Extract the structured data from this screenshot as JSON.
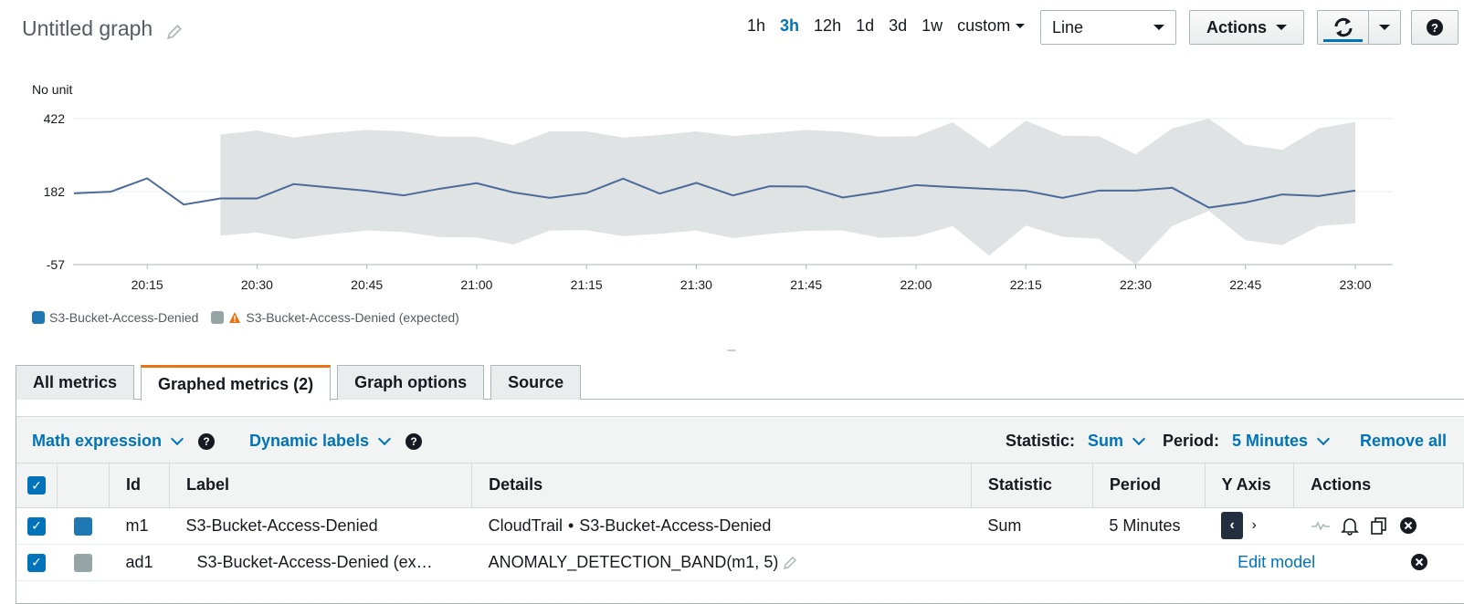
{
  "header": {
    "title": "Untitled graph",
    "time_ranges": [
      "1h",
      "3h",
      "12h",
      "1d",
      "3d",
      "1w"
    ],
    "active_range": "3h",
    "custom_label": "custom",
    "chart_type": "Line",
    "actions_label": "Actions"
  },
  "chart": {
    "unit_label": "No unit",
    "legend": [
      "S3-Bucket-Access-Denied",
      "S3-Bucket-Access-Denied (expected)"
    ],
    "splitter": "---"
  },
  "colors": {
    "series_line": "#4c6a9a",
    "band_fill": "#dfe3e4",
    "m1_swatch": "#1f77b4",
    "ad1_swatch": "#95a5a6",
    "warning": "#ec7211",
    "accent": "#0073bb"
  },
  "chart_data": {
    "type": "area",
    "ylabel": "No unit",
    "yticks": [
      422,
      182,
      -57
    ],
    "ylim": [
      -57,
      422
    ],
    "xticks": [
      "20:15",
      "20:30",
      "20:45",
      "21:00",
      "21:15",
      "21:30",
      "21:45",
      "22:00",
      "22:15",
      "22:30",
      "22:45",
      "23:00"
    ],
    "x": [
      "20:05",
      "20:10",
      "20:15",
      "20:20",
      "20:25",
      "20:30",
      "20:35",
      "20:40",
      "20:45",
      "20:50",
      "20:55",
      "21:00",
      "21:05",
      "21:10",
      "21:15",
      "21:20",
      "21:25",
      "21:30",
      "21:35",
      "21:40",
      "21:45",
      "21:50",
      "21:55",
      "22:00",
      "22:05",
      "22:10",
      "22:15",
      "22:20",
      "22:25",
      "22:30",
      "22:35",
      "22:40",
      "22:45",
      "22:50",
      "22:55",
      "23:00"
    ],
    "series": [
      {
        "name": "S3-Bucket-Access-Denied",
        "values": [
          177,
          182,
          226,
          140,
          160,
          160,
          207,
          196,
          185,
          170,
          192,
          210,
          180,
          162,
          178,
          225,
          176,
          211,
          170,
          200,
          199,
          163,
          181,
          204,
          197,
          191,
          185,
          162,
          186,
          186,
          195,
          130,
          147,
          173,
          168,
          186
        ]
      },
      {
        "name": "S3-Bucket-Access-Denied (expected)",
        "upper": [
          null,
          null,
          null,
          null,
          370,
          383,
          360,
          375,
          385,
          380,
          363,
          363,
          335,
          380,
          380,
          360,
          368,
          380,
          365,
          374,
          385,
          379,
          363,
          364,
          410,
          325,
          415,
          366,
          364,
          305,
          390,
          422,
          336,
          320,
          390,
          411
        ],
        "lower": [
          null,
          null,
          null,
          null,
          38,
          48,
          27,
          42,
          55,
          50,
          33,
          32,
          9,
          55,
          56,
          36,
          44,
          55,
          30,
          44,
          54,
          55,
          31,
          35,
          69,
          -27,
          71,
          34,
          28,
          -57,
          70,
          119,
          23,
          7,
          69,
          78
        ]
      }
    ]
  },
  "tabs": [
    "All metrics",
    "Graphed metrics (2)",
    "Graph options",
    "Source"
  ],
  "toolbar": {
    "math_expression": "Math expression",
    "dynamic_labels": "Dynamic labels",
    "statistic_label": "Statistic:",
    "statistic_value": "Sum",
    "period_label": "Period:",
    "period_value": "5 Minutes",
    "remove_all": "Remove all"
  },
  "table": {
    "headers": [
      "Id",
      "Label",
      "Details",
      "Statistic",
      "Period",
      "Y Axis",
      "Actions"
    ],
    "rows": [
      {
        "id": "m1",
        "label": "S3-Bucket-Access-Denied",
        "details_ns": "CloudTrail",
        "details_metric": "S3-Bucket-Access-Denied",
        "statistic": "Sum",
        "period": "5 Minutes"
      },
      {
        "id": "ad1",
        "label": "S3-Bucket-Access-Denied (ex…",
        "details": "ANOMALY_DETECTION_BAND(m1, 5)",
        "edit_model": "Edit model"
      }
    ]
  }
}
